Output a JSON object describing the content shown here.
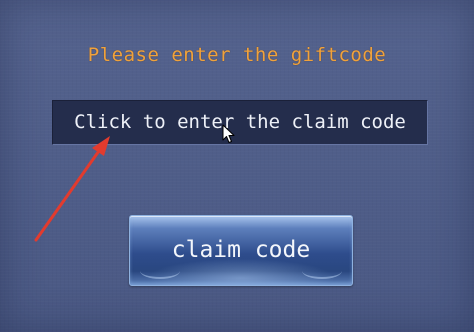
{
  "dialog": {
    "prompt_text": "Please enter the giftcode",
    "code_field": {
      "placeholder": "Click to enter the claim code"
    },
    "claim_button_label": "claim code"
  },
  "colors": {
    "background": "#4d5c89",
    "prompt_text": "#f0a23c",
    "field_background": "#242d4c",
    "button_body": "#2e4c8c",
    "annotation_arrow": "#e23b2e"
  },
  "icons": {
    "annotation": "red-arrow-icon",
    "pointer": "mouse-cursor-icon"
  }
}
